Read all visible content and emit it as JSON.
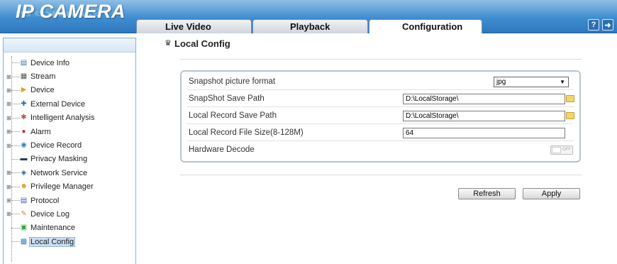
{
  "header": {
    "logo": "IP CAMERA",
    "tabs": [
      {
        "label": "Live Video",
        "active": false
      },
      {
        "label": "Playback",
        "active": false
      },
      {
        "label": "Configuration",
        "active": true
      }
    ],
    "buttons": [
      {
        "icon": "help-icon"
      },
      {
        "icon": "logout-icon"
      }
    ]
  },
  "sidebar": {
    "items": [
      {
        "label": "Device Info",
        "icon": "info-icon",
        "expandable": false
      },
      {
        "label": "Stream",
        "icon": "stream-icon",
        "expandable": true
      },
      {
        "label": "Device",
        "icon": "device-icon",
        "expandable": true
      },
      {
        "label": "External Device",
        "icon": "external-device-icon",
        "expandable": true
      },
      {
        "label": "Intelligent Analysis",
        "icon": "analysis-icon",
        "expandable": true
      },
      {
        "label": "Alarm",
        "icon": "alarm-icon",
        "expandable": true
      },
      {
        "label": "Device Record",
        "icon": "record-icon",
        "expandable": true
      },
      {
        "label": "Privacy Masking",
        "icon": "privacy-icon",
        "expandable": false
      },
      {
        "label": "Network Service",
        "icon": "network-icon",
        "expandable": true
      },
      {
        "label": "Privilege Manager",
        "icon": "users-icon",
        "expandable": true
      },
      {
        "label": "Protocol",
        "icon": "protocol-icon",
        "expandable": true
      },
      {
        "label": "Device Log",
        "icon": "log-icon",
        "expandable": true
      },
      {
        "label": "Maintenance",
        "icon": "maintenance-icon",
        "expandable": false
      },
      {
        "label": "Local Config",
        "icon": "local-config-icon",
        "expandable": false,
        "selected": true
      }
    ]
  },
  "content": {
    "title": "Local Config",
    "rows": {
      "snapshot_format": {
        "label": "Snapshot picture format",
        "value": "jpg"
      },
      "snapshot_path": {
        "label": "SnapShot Save Path",
        "value": "D:\\LocalStorage\\"
      },
      "record_path": {
        "label": "Local Record Save Path",
        "value": "D:\\LocalStorage\\"
      },
      "record_size": {
        "label": "Local Record File Size(8-128M)",
        "value": "64"
      },
      "hardware_decode": {
        "label": "Hardware Decode",
        "toggle_text": "OFF"
      }
    },
    "buttons": {
      "refresh": "Refresh",
      "apply": "Apply"
    }
  }
}
